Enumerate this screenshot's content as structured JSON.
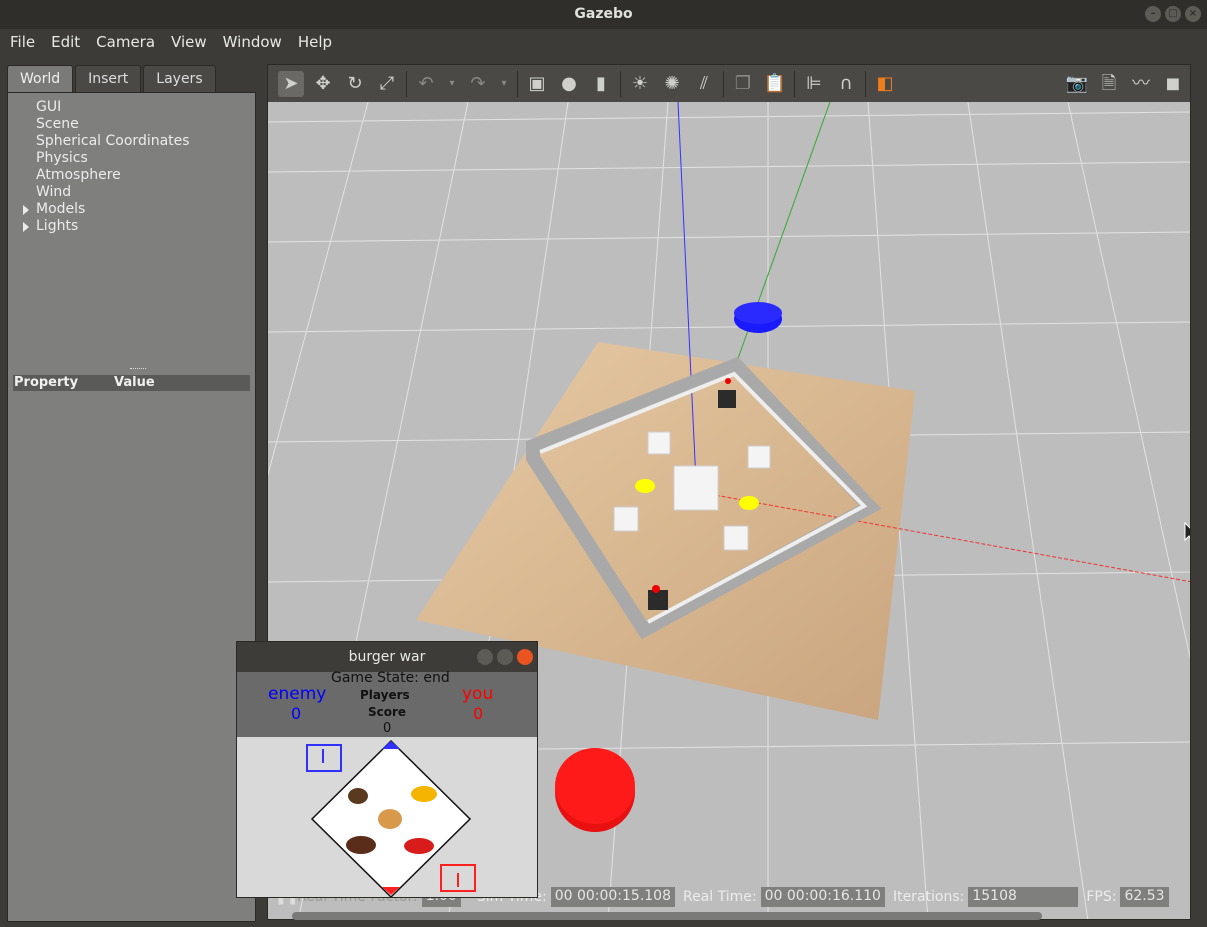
{
  "window": {
    "title": "Gazebo"
  },
  "menu": [
    "File",
    "Edit",
    "Camera",
    "View",
    "Window",
    "Help"
  ],
  "left_panel": {
    "tabs": [
      "World",
      "Insert",
      "Layers"
    ],
    "tree": [
      "GUI",
      "Scene",
      "Spherical Coordinates",
      "Physics",
      "Atmosphere",
      "Wind",
      "Models",
      "Lights"
    ],
    "property_header": {
      "property": "Property",
      "value": "Value"
    }
  },
  "status": {
    "real_time_factor_label": "Real Time Factor:",
    "real_time_factor": "1.00",
    "sim_time_label": "Sim Time:",
    "sim_time": "00 00:00:15.108",
    "real_time_label": "Real Time:",
    "real_time": "00 00:00:16.110",
    "iterations_label": "Iterations:",
    "iterations": "15108",
    "fps_label": "FPS:",
    "fps": "62.53"
  },
  "burger_war": {
    "title": "burger war",
    "game_state": "Game State: end",
    "enemy_label": "enemy",
    "enemy_score": "0",
    "you_label": "you",
    "you_score": "0",
    "players_label": "Players",
    "score_label": "Score",
    "center_score": "0"
  },
  "colors": {
    "enemy": "#0000ff",
    "you": "#ff0000",
    "yellow_marker": "#ffff00"
  }
}
